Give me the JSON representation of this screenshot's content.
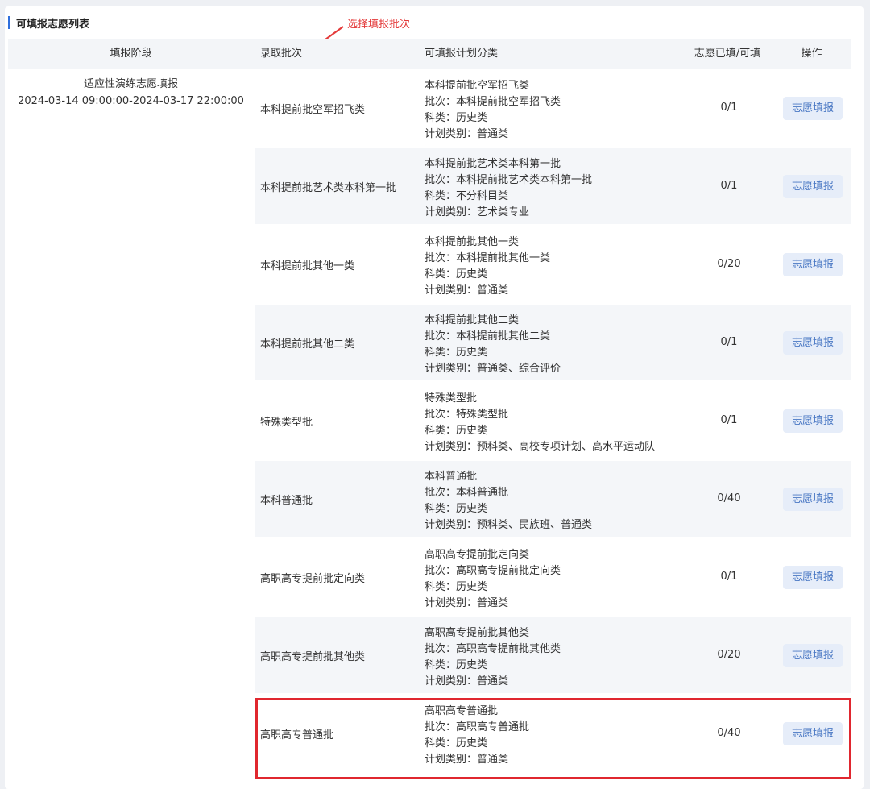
{
  "section_title": "可填报志愿列表",
  "annotation": {
    "text": "选择填报批次",
    "color": "#e43a3a"
  },
  "table": {
    "headers": {
      "stage": "填报阶段",
      "batch": "录取批次",
      "plan": "可填报计划分类",
      "count": "志愿已填/可填",
      "operation": "操作"
    },
    "stage": {
      "name": "适应性演练志愿填报",
      "period": "2024-03-14 09:00:00-2024-03-17 22:00:00"
    },
    "rows": [
      {
        "batch": "本科提前批空军招飞类",
        "plan": [
          "本科提前批空军招飞类",
          "批次：本科提前批空军招飞类",
          "科类：历史类",
          "计划类别：普通类"
        ],
        "count": "0/1",
        "button": "志愿填报"
      },
      {
        "batch": "本科提前批艺术类本科第一批",
        "plan": [
          "本科提前批艺术类本科第一批",
          "批次：本科提前批艺术类本科第一批",
          "科类：不分科目类",
          "计划类别：艺术类专业"
        ],
        "count": "0/1",
        "button": "志愿填报"
      },
      {
        "batch": "本科提前批其他一类",
        "plan": [
          "本科提前批其他一类",
          "批次：本科提前批其他一类",
          "科类：历史类",
          "计划类别：普通类"
        ],
        "count": "0/20",
        "button": "志愿填报"
      },
      {
        "batch": "本科提前批其他二类",
        "plan": [
          "本科提前批其他二类",
          "批次：本科提前批其他二类",
          "科类：历史类",
          "计划类别：普通类、综合评价"
        ],
        "count": "0/1",
        "button": "志愿填报"
      },
      {
        "batch": "特殊类型批",
        "plan": [
          "特殊类型批",
          "批次：特殊类型批",
          "科类：历史类",
          "计划类别：预科类、高校专项计划、高水平运动队"
        ],
        "count": "0/1",
        "button": "志愿填报"
      },
      {
        "batch": "本科普通批",
        "plan": [
          "本科普通批",
          "批次：本科普通批",
          "科类：历史类",
          "计划类别：预科类、民族班、普通类"
        ],
        "count": "0/40",
        "button": "志愿填报"
      },
      {
        "batch": "高职高专提前批定向类",
        "plan": [
          "高职高专提前批定向类",
          "批次：高职高专提前批定向类",
          "科类：历史类",
          "计划类别：普通类"
        ],
        "count": "0/1",
        "button": "志愿填报"
      },
      {
        "batch": "高职高专提前批其他类",
        "plan": [
          "高职高专提前批其他类",
          "批次：高职高专提前批其他类",
          "科类：历史类",
          "计划类别：普通类"
        ],
        "count": "0/20",
        "button": "志愿填报"
      },
      {
        "batch": "高职高专普通批",
        "plan": [
          "高职高专普通批",
          "批次：高职高专普通批",
          "科类：历史类",
          "计划类别：普通类"
        ],
        "count": "0/40",
        "button": "志愿填报"
      }
    ]
  },
  "highlight_color": "#e0272f"
}
